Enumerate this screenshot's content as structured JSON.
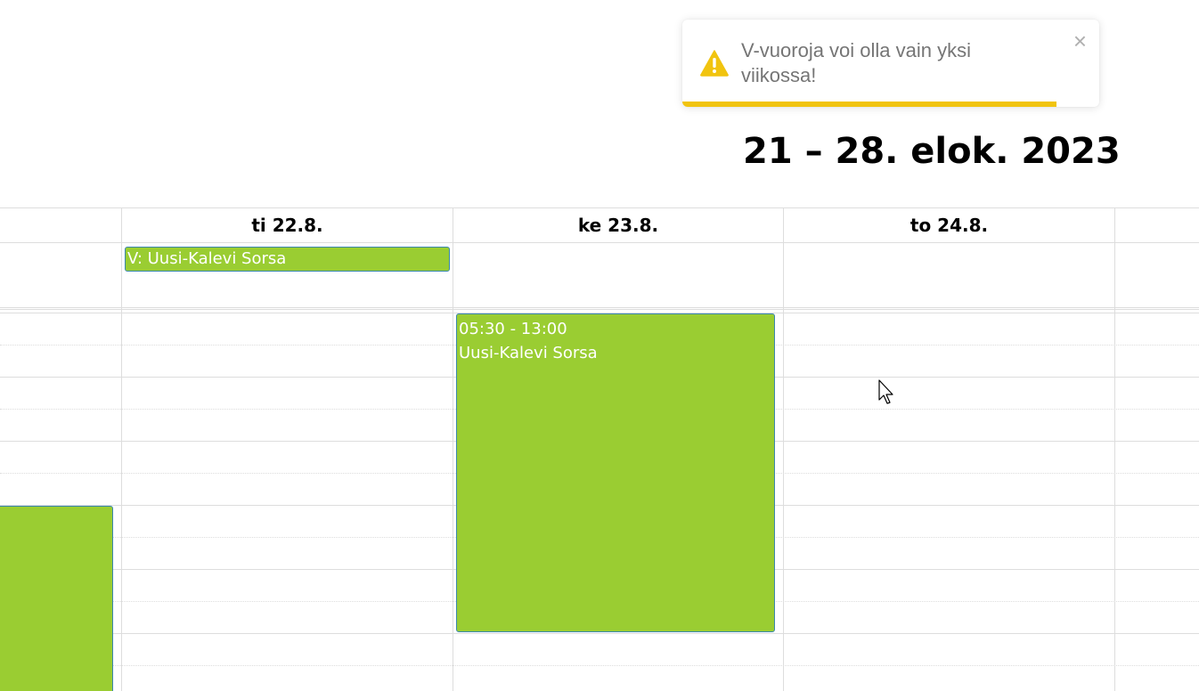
{
  "toast": {
    "message": "V-vuoroja voi olla vain yksi viikossa!",
    "close_label": "×",
    "icon": "warning-icon",
    "accent_color": "#f1c40f"
  },
  "calendar": {
    "title": "21 – 28. elok. 2023",
    "days": [
      {
        "label": "ti 22.8."
      },
      {
        "label": "ke 23.8."
      },
      {
        "label": "to 24.8."
      }
    ],
    "allday_events": [
      {
        "label": "V: Uusi-Kalevi Sorsa"
      }
    ],
    "events": [
      {
        "time": "05:30 - 13:00",
        "title": "Uusi-Kalevi Sorsa"
      }
    ],
    "event_color": "#9acd32"
  }
}
